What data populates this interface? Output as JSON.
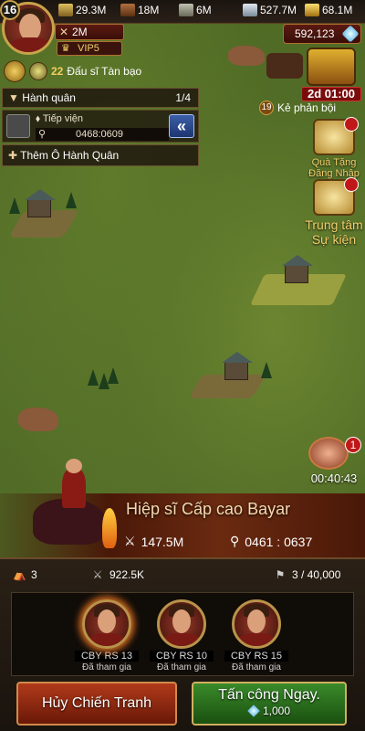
{
  "player": {
    "level": "16",
    "power": "2M",
    "vip": "VIP5",
    "title_count": "22",
    "title": "Đấu sĩ Tàn bạo"
  },
  "resources": [
    {
      "icon": "food-icon",
      "value": "29.3M"
    },
    {
      "icon": "wood-icon",
      "value": "18M"
    },
    {
      "icon": "stone-icon",
      "value": "6M"
    },
    {
      "icon": "ore-icon",
      "value": "527.7M"
    },
    {
      "icon": "gold-icon",
      "value": "68.1M"
    }
  ],
  "gems": "592,123",
  "march": {
    "header": "Hành quân",
    "count": "1/4",
    "row_label": "Tiếp viện",
    "row_coord": "0468:0609",
    "add_label": "Thêm Ô Hành Quân"
  },
  "right": {
    "chest_timer": "2d 01:00",
    "enemy_count": "19",
    "enemy_label": "Kẻ phản bội",
    "gift_label": "Quà Tặng Đăng Nhập",
    "event_label": "Trung tâm Sự kiện",
    "war_badge": "1",
    "war_timer": "00:40:43"
  },
  "rally": {
    "hero_name": "Hiệp sĩ Cấp cao Bayar",
    "power": "147.5M",
    "coord": "0461 : 0637",
    "joined_count": "3",
    "troop_power": "922.5K",
    "capacity": "3 / 40,000",
    "members": [
      {
        "tag": "CBY RS 13",
        "status": "Đã tham gia"
      },
      {
        "tag": "CBY RS 10",
        "status": "Đã tham gia"
      },
      {
        "tag": "CBY RS 15",
        "status": "Đã tham gia"
      }
    ],
    "cancel_label": "Hủy Chiến Tranh",
    "attack_label": "Tấn công Ngay.",
    "attack_cost": "1,000"
  },
  "colors": {
    "accent_gold": "#c9a24a",
    "cancel_red": "#b03a1a",
    "attack_green": "#3a8a2a"
  }
}
